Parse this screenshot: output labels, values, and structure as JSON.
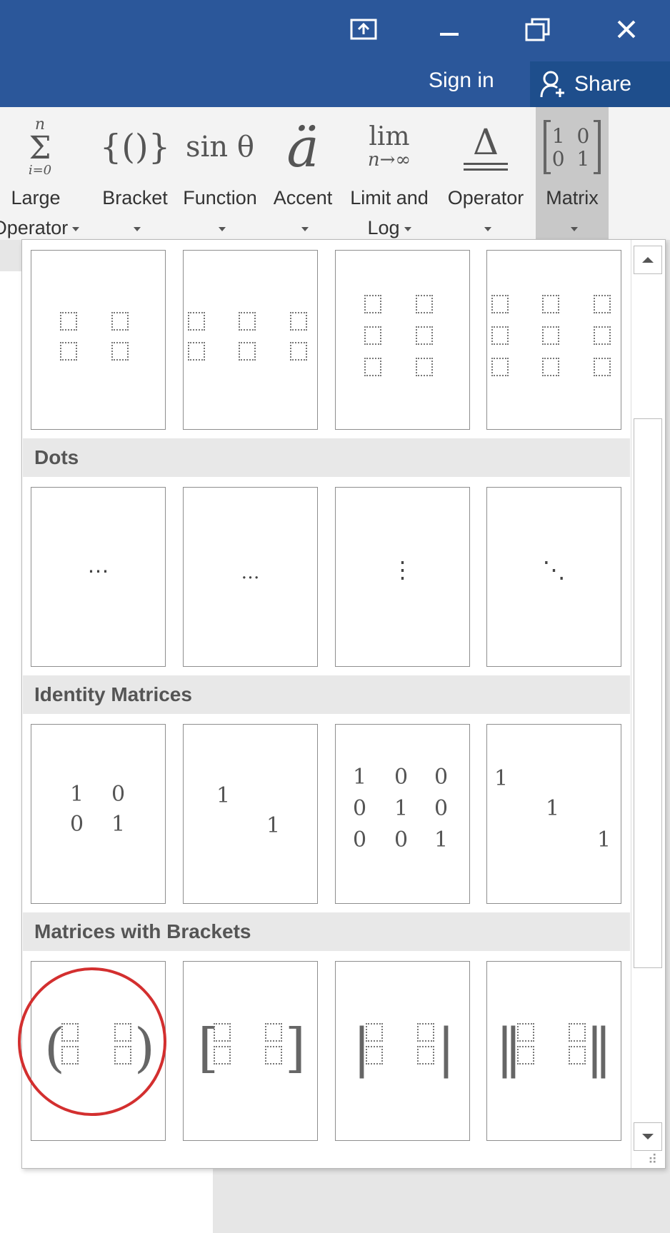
{
  "window_controls": {
    "ribbon_options_icon": "ribbon-display-icon",
    "minimize_icon": "minimize-icon",
    "restore_icon": "restore-icon",
    "close_icon": "close-icon"
  },
  "account": {
    "sign_in": "Sign in",
    "share": "Share"
  },
  "ribbon": {
    "items": [
      {
        "line1": "Large",
        "line2": "Operator",
        "glyph": "Σ"
      },
      {
        "line1": "Bracket",
        "line2": "",
        "glyph": "{()}"
      },
      {
        "line1": "Function",
        "line2": "",
        "glyph": "sin θ"
      },
      {
        "line1": "Accent",
        "line2": "",
        "glyph": "ä"
      },
      {
        "line1": "Limit and",
        "line2": "Log",
        "glyph": "lim"
      },
      {
        "line1": "Operator",
        "line2": "",
        "glyph": "Δ"
      },
      {
        "line1": "Matrix",
        "line2": "",
        "glyph": "1 0 / 0 1"
      }
    ],
    "large_op_top": "n",
    "large_op_bottom": "i=0",
    "lim_sub": "n→∞",
    "matrix_row1": "1 0",
    "matrix_row2": "0 1"
  },
  "gallery": {
    "sections": [
      {
        "title": "Dots"
      },
      {
        "title": "Identity Matrices"
      },
      {
        "title": "Matrices with Brackets"
      }
    ],
    "dots": {
      "center": "⋯",
      "baseline": "…",
      "vertical": "⋮",
      "diagonal": "⋱"
    },
    "identity_2x2": [
      [
        "1",
        "0"
      ],
      [
        "0",
        "1"
      ]
    ],
    "identity_2x2_diag": [
      "1",
      "1"
    ],
    "identity_3x3": [
      [
        "1",
        "0",
        "0"
      ],
      [
        "0",
        "1",
        "0"
      ],
      [
        "0",
        "0",
        "1"
      ]
    ],
    "identity_3x3_diag": [
      "1",
      "1",
      "1"
    ],
    "brackets": {
      "paren_left": "(",
      "paren_right": ")",
      "square_left": "[",
      "square_right": "]",
      "bar_left": "|",
      "bar_right": "|",
      "double_left": "‖",
      "double_right": "‖"
    }
  },
  "colors": {
    "titlebar": "#2b579a",
    "highlight_circle": "#d32f2f"
  }
}
